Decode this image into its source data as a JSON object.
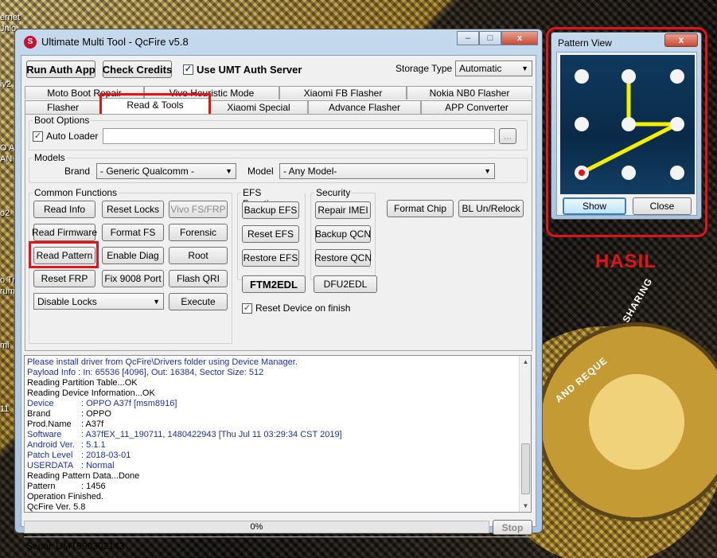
{
  "desktop": {
    "icon_texts": [
      "ernet",
      "Jnlo",
      "iv2",
      "O A",
      "AN",
      "o2",
      "o Tr",
      "rum",
      "mi",
      "11"
    ]
  },
  "medal": {
    "text1": "SHARING",
    "text2": "AND REQUE",
    "hasil": "HASIL"
  },
  "window": {
    "title": "Ultimate Multi Tool - QcFire v5.8",
    "minimize": "–",
    "maximize": "□",
    "close": "x"
  },
  "toolbar": {
    "run_auth": "Run Auth App",
    "check_credits": "Check Credits",
    "use_umt": "Use UMT Auth Server",
    "storage_label": "Storage Type",
    "storage_value": "Automatic"
  },
  "tabs": {
    "row1": [
      "Moto Boot Repair",
      "Vivo Heuristic Mode",
      "Xiaomi FB Flasher",
      "Nokia NB0 Flasher"
    ],
    "row2": [
      "Flasher",
      "Read & Tools",
      "Xiaomi Special",
      "Advance Flasher",
      "APP Converter"
    ]
  },
  "boot": {
    "label": "Boot Options",
    "auto_loader": "Auto Loader",
    "browse": "..."
  },
  "models": {
    "label": "Models",
    "brand_label": "Brand",
    "brand_value": "- Generic Qualcomm -",
    "model_label": "Model",
    "model_value": "- Any Model-"
  },
  "common": {
    "label": "Common Functions",
    "read_info": "Read Info",
    "reset_locks": "Reset Locks",
    "vivo_fs": "Vivo FS/FRP",
    "read_firmware": "Read Firmware",
    "format_fs": "Format FS",
    "forensic": "Forensic",
    "read_pattern": "Read Pattern",
    "enable_diag": "Enable Diag",
    "root": "Root",
    "reset_frp": "Reset FRP",
    "fix_9008": "Fix 9008 Port",
    "flash_qri": "Flash QRI",
    "disable_locks": "Disable Locks",
    "execute": "Execute"
  },
  "efs": {
    "label": "EFS Functions",
    "backup": "Backup EFS",
    "reset": "Reset EFS",
    "restore": "Restore EFS",
    "ftm2edl": "FTM2EDL"
  },
  "security": {
    "label": "Security",
    "repair_imei": "Repair IMEI",
    "backup_qcn": "Backup QCN",
    "restore_qcn": "Restore QCN",
    "dfu2edl": "DFU2EDL"
  },
  "extra": {
    "format_chip": "Format Chip",
    "bl_unrelock": "BL Un/Relock",
    "reset_device": "Reset Device on finish"
  },
  "log": {
    "lines": [
      {
        "k": "Please install driver from QcFire\\Drivers folder using Device Manager.",
        "v": "",
        "blue": true
      },
      {
        "k": "Payload Info  : In: 65536 [4096], Out: 16384, Sector Size: 512",
        "v": "",
        "blue": true
      },
      {
        "k": "Reading Partition Table...OK",
        "v": "",
        "blue": false
      },
      {
        "k": "Reading Device Information...OK",
        "v": "",
        "blue": false
      },
      {
        "k": "Device",
        "v": ": OPPO A37f [msm8916]",
        "blue": true
      },
      {
        "k": "Brand",
        "v": ": OPPO",
        "blue": false
      },
      {
        "k": "Prod.Name",
        "v": ": A37f",
        "blue": false
      },
      {
        "k": "Software",
        "v": ": A37fEX_11_190711, 1480422943 [Thu Jul 11 03:29:34 CST 2019]",
        "blue": true
      },
      {
        "k": "Android Ver.",
        "v": ": 5.1.1",
        "blue": true
      },
      {
        "k": "Patch Level",
        "v": ": 2018-03-01",
        "blue": true
      },
      {
        "k": "USERDATA",
        "v": ": Normal",
        "blue": true
      },
      {
        "k": "Reading Pattern Data...Done",
        "v": "",
        "blue": false
      },
      {
        "k": "Pattern",
        "v": ": 1456",
        "blue": false
      },
      {
        "k": "Operation Finished.",
        "v": "",
        "blue": false
      },
      {
        "k": "QcFire Ver. 5.8",
        "v": "",
        "blue": false
      }
    ]
  },
  "progress": {
    "text": "0%",
    "value": 0,
    "stop": "Stop"
  },
  "status": {
    "serial": "Serial: UMT990302143"
  },
  "pattern_view": {
    "title": "Pattern View",
    "close_x": "x",
    "show": "Show",
    "close": "Close",
    "pattern": [
      1,
      4,
      5,
      6
    ]
  },
  "colors": {
    "highlight": "#e2141a",
    "pattern_line": "#f5f000",
    "log_blue": "#1a2fa8"
  }
}
